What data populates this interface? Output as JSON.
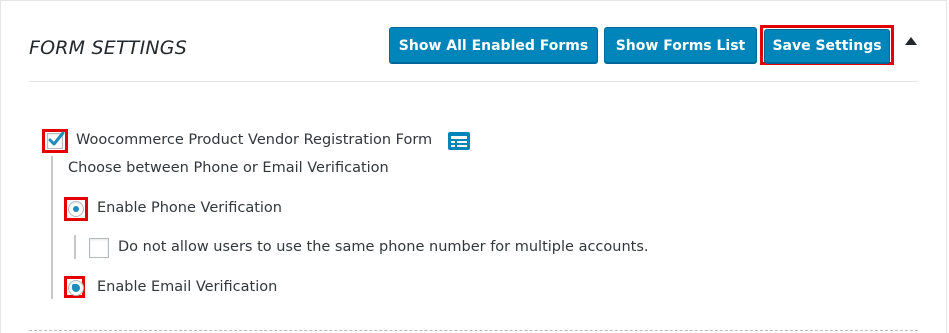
{
  "header": {
    "title": "FORM SETTINGS",
    "buttons": {
      "show_all_enabled": "Show All Enabled Forms",
      "show_list": "Show Forms List",
      "save": "Save Settings"
    }
  },
  "form": {
    "name": "Woocommerce Product Vendor Registration Form",
    "enabled": true,
    "verification_prompt": "Choose between Phone or Email Verification",
    "options": {
      "phone": {
        "label": "Enable Phone Verification",
        "selected": true,
        "sub_option": {
          "label": "Do not allow users to use the same phone number for multiple accounts.",
          "checked": false
        }
      },
      "email": {
        "label": "Enable Email Verification",
        "selected": false
      }
    }
  },
  "icons": [
    "collapse-arrow-icon",
    "checkmark-icon",
    "form-list-icon"
  ],
  "colors": {
    "primary_button": "#0085ba",
    "highlight": "#e40000",
    "radio_dot": "#1e8cbe"
  }
}
